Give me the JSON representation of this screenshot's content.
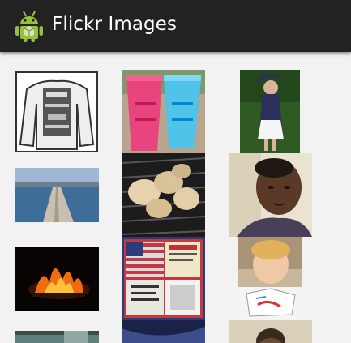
{
  "app": {
    "title": "Flickr Images",
    "icon": "android-robot-icon",
    "colors": {
      "actionbar": "#222222",
      "android_green": "#97c03d",
      "background": "#f2f2f2"
    }
  },
  "grid": {
    "columns": 3,
    "photos": [
      {
        "name": "photo-sweatshirt"
      },
      {
        "name": "photo-pink-blue-cups"
      },
      {
        "name": "photo-girl-in-garden"
      },
      {
        "name": "photo-lake-dock"
      },
      {
        "name": "photo-grilled-chicken"
      },
      {
        "name": "photo-man-selfie"
      },
      {
        "name": "photo-campfire"
      },
      {
        "name": "photo-memorial-day-collage"
      },
      {
        "name": "photo-child-at-table"
      },
      {
        "name": "photo-partial-water"
      },
      {
        "name": "photo-partial-night-sky"
      },
      {
        "name": "photo-partial-person"
      }
    ]
  }
}
